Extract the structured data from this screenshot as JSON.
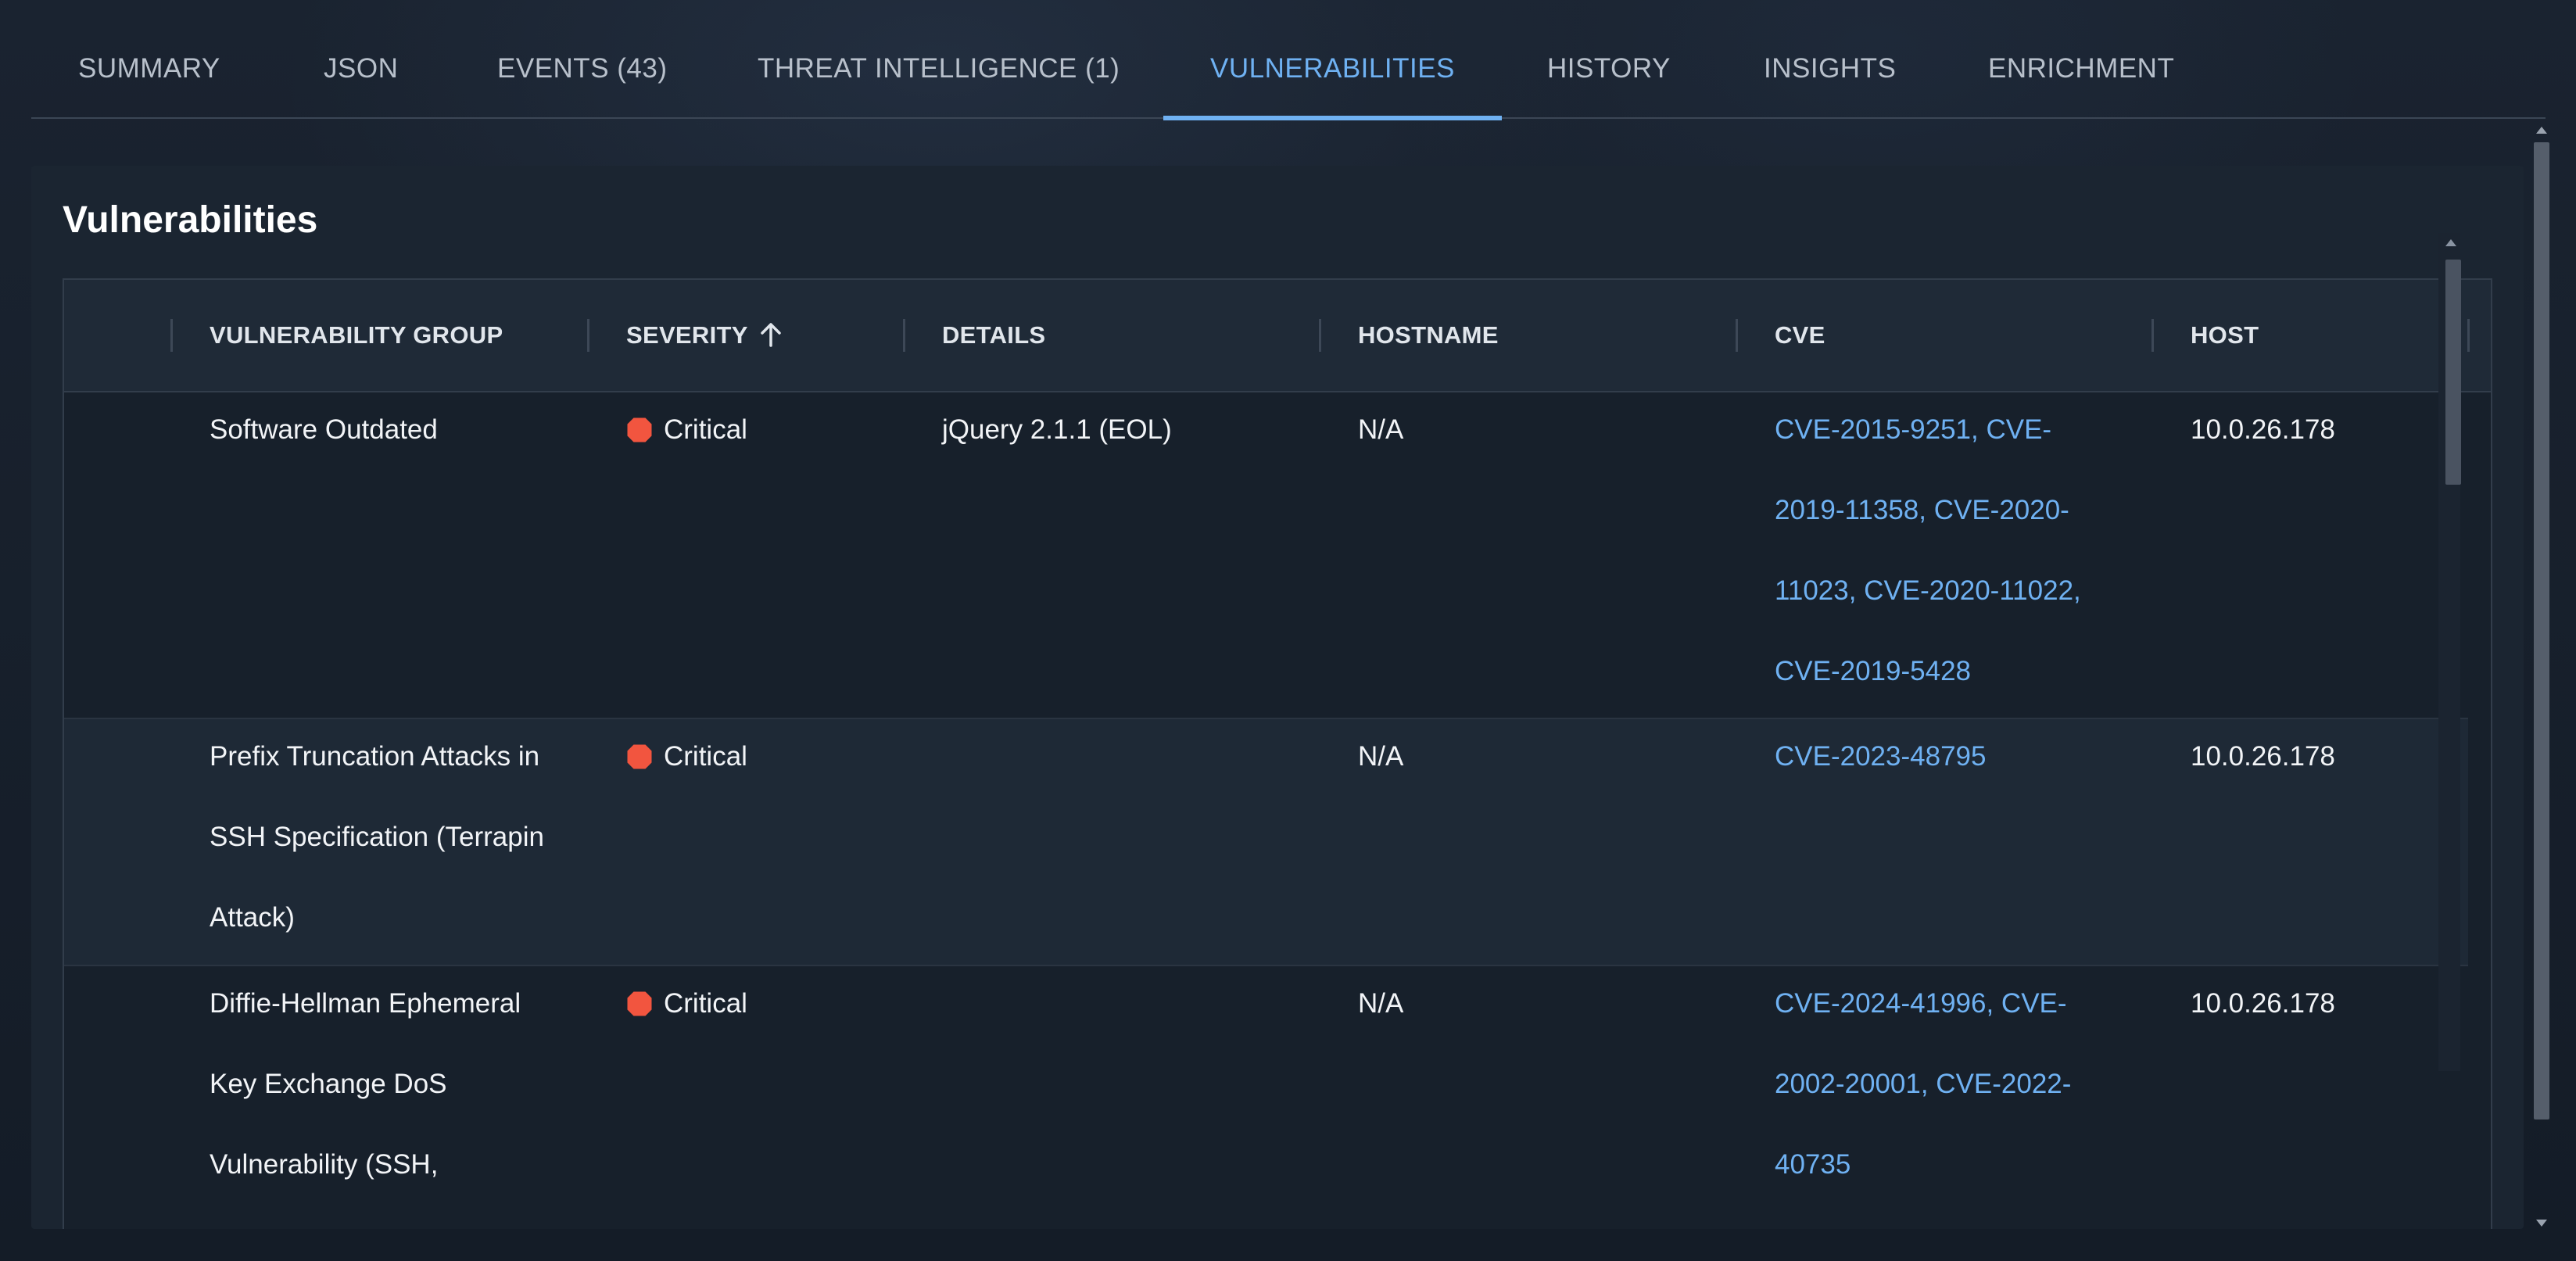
{
  "tabs": [
    {
      "label": "SUMMARY"
    },
    {
      "label": "JSON"
    },
    {
      "label": "EVENTS (43)"
    },
    {
      "label": "THREAT INTELLIGENCE (1)"
    },
    {
      "label": "VULNERABILITIES",
      "active": true
    },
    {
      "label": "HISTORY"
    },
    {
      "label": "INSIGHTS"
    },
    {
      "label": "ENRICHMENT"
    }
  ],
  "panel": {
    "title": "Vulnerabilities"
  },
  "table": {
    "columns": [
      {
        "label": "VULNERABILITY GROUP"
      },
      {
        "label": "SEVERITY",
        "sort": "ascending",
        "sort_icon": "arrow-up-icon"
      },
      {
        "label": "DETAILS"
      },
      {
        "label": "HOSTNAME"
      },
      {
        "label": "CVE"
      },
      {
        "label": "HOST"
      }
    ],
    "rows": [
      {
        "group": "Software Outdated",
        "severity": "Critical",
        "details": "jQuery 2.1.1 (EOL)",
        "hostname": "N/A",
        "cve": "CVE-2015-9251, CVE-2019-11358, CVE-2020-11023, CVE-2020-11022, CVE-2019-5428",
        "host": "10.0.26.178"
      },
      {
        "group": "Prefix Truncation Attacks in SSH Specification (Terrapin Attack)",
        "severity": "Critical",
        "details": "",
        "hostname": "N/A",
        "cve": "CVE-2023-48795",
        "host": "10.0.26.178"
      },
      {
        "group": "Diffie-Hellman Ephemeral Key Exchange DoS Vulnerability (SSH,",
        "severity": "Critical",
        "details": "",
        "hostname": "N/A",
        "cve": "CVE-2024-41996, CVE-2002-20001, CVE-2022-40735",
        "host": "10.0.26.178"
      }
    ]
  },
  "colors": {
    "accent": "#6fb1f2",
    "critical": "#f2553f",
    "background": "#121a24",
    "panel": "#1b2531"
  }
}
